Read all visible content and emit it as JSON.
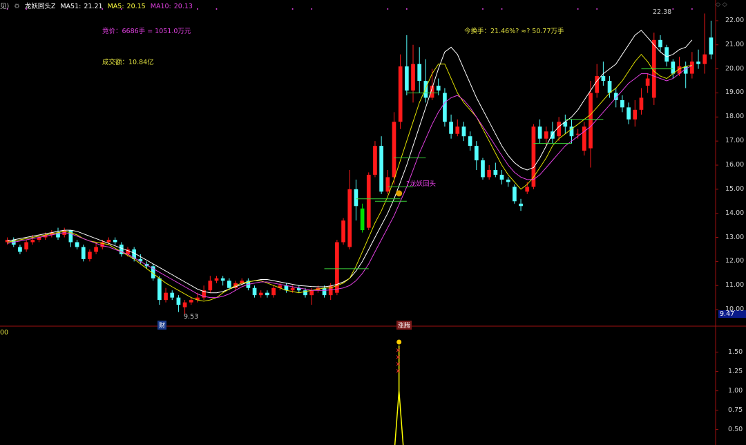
{
  "header": {
    "prefix": "见)",
    "indicator_name": "龙妖回头Z",
    "ma51_label": "MA51:",
    "ma51_value": "21.21",
    "ma5_label": "MA5:",
    "ma5_value": "20.15",
    "ma10_label": "MA10:",
    "ma10_value": "20.13"
  },
  "annotations": {
    "bid_text": "竞价：6686手 = 1051.0万元",
    "volume_text": "成交额：10.84亿",
    "turnover_text": "今换手：21.46%? ≈? 50.77万手",
    "pattern_label": "?龙妖回头",
    "high_label": "22.38",
    "low_label": "9.53",
    "current_price": "9.47",
    "lower_left": "00",
    "cai_marker": "财",
    "zhangting_marker": "涨腾"
  },
  "colors": {
    "up": "#ff1a1a",
    "down": "#54ffff",
    "green_bar": "#00e000",
    "ma5": "#ffffff",
    "ma10": "#e0e000",
    "ma20": "#e040e0",
    "signal": "#ffff00",
    "axis": "#a01010"
  },
  "chart_data": [
    {
      "type": "candlestick",
      "title": "",
      "y_ticks": [
        "22.00",
        "21.00",
        "20.00",
        "19.00",
        "18.00",
        "17.00",
        "16.00",
        "15.00",
        "14.00",
        "13.00",
        "12.00",
        "11.00",
        "10.00"
      ],
      "ylim": [
        9.6,
        22.4
      ],
      "series": [
        {
          "name": "MA51",
          "values": [
            12.85,
            12.9,
            12.95,
            13.0,
            13.05,
            13.1,
            13.15,
            13.2,
            13.25,
            13.3,
            13.3,
            13.25,
            13.15,
            13.05,
            12.95,
            12.85,
            12.75,
            12.65,
            12.55,
            12.45,
            12.35,
            12.2,
            12.05,
            11.9,
            11.75,
            11.6,
            11.45,
            11.3,
            11.15,
            11.0,
            10.85,
            10.75,
            10.7,
            10.7,
            10.75,
            10.85,
            10.95,
            11.05,
            11.15,
            11.2,
            11.25,
            11.25,
            11.2,
            11.15,
            11.1,
            11.05,
            11.0,
            10.98,
            10.96,
            10.95,
            10.95,
            10.98,
            11.05,
            11.15,
            11.3,
            11.6,
            12.0,
            12.5,
            13.0,
            13.5,
            14.0,
            14.6,
            15.3,
            16.0,
            16.8,
            17.6,
            18.4,
            19.2,
            20.0,
            20.7,
            20.9,
            20.6,
            20.0,
            19.4,
            18.8,
            18.3,
            17.8,
            17.3,
            16.8,
            16.4,
            16.1,
            15.9,
            15.8,
            15.9,
            16.3,
            16.8,
            17.3,
            17.6,
            17.8,
            18.0,
            18.3,
            18.7,
            19.1,
            19.5,
            19.8,
            20.0,
            20.2,
            20.6,
            21.0,
            21.4,
            21.6,
            21.3,
            21.0,
            20.7,
            20.5,
            20.6,
            20.8,
            20.9,
            21.2
          ]
        },
        {
          "name": "MA5",
          "values": [
            12.8,
            12.85,
            12.9,
            12.95,
            13.0,
            13.05,
            13.1,
            13.15,
            13.2,
            13.25,
            13.2,
            13.1,
            12.95,
            12.85,
            12.8,
            12.75,
            12.7,
            12.55,
            12.4,
            12.25,
            12.1,
            11.9,
            11.7,
            11.5,
            11.3,
            11.1,
            10.95,
            10.8,
            10.65,
            10.5,
            10.4,
            10.35,
            10.4,
            10.5,
            10.7,
            10.85,
            11.0,
            11.1,
            11.15,
            11.2,
            11.2,
            11.1,
            11.0,
            10.9,
            10.8,
            10.75,
            10.7,
            10.75,
            10.8,
            10.85,
            10.9,
            10.9,
            11.0,
            11.1,
            11.3,
            11.8,
            12.4,
            13.0,
            13.6,
            14.1,
            14.7,
            15.4,
            16.2,
            17.0,
            17.8,
            18.6,
            19.2,
            19.8,
            20.2,
            20.2,
            19.6,
            19.0,
            18.6,
            18.3,
            18.0,
            17.5,
            17.0,
            16.5,
            16.0,
            15.6,
            15.3,
            15.0,
            15.2,
            15.5,
            15.9,
            16.3,
            16.8,
            17.1,
            17.3,
            17.5,
            17.7,
            17.9,
            18.1,
            18.4,
            18.7,
            19.0,
            19.2,
            19.5,
            19.9,
            20.3,
            20.6,
            20.3,
            19.9,
            19.7,
            19.6,
            19.8,
            20.0,
            20.1,
            20.15
          ]
        },
        {
          "name": "MA10",
          "values": [
            12.75,
            12.8,
            12.85,
            12.9,
            12.95,
            13.0,
            13.05,
            13.1,
            13.15,
            13.2,
            13.15,
            13.05,
            12.95,
            12.85,
            12.75,
            12.65,
            12.6,
            12.5,
            12.4,
            12.3,
            12.15,
            12.0,
            11.85,
            11.7,
            11.55,
            11.4,
            11.25,
            11.1,
            10.95,
            10.8,
            10.65,
            10.55,
            10.5,
            10.5,
            10.55,
            10.65,
            10.8,
            10.95,
            11.05,
            11.1,
            11.15,
            11.15,
            11.1,
            11.05,
            11.0,
            10.95,
            10.9,
            10.85,
            10.8,
            10.8,
            10.8,
            10.82,
            10.85,
            10.9,
            11.0,
            11.2,
            11.5,
            11.9,
            12.4,
            12.9,
            13.4,
            13.9,
            14.5,
            15.1,
            15.8,
            16.5,
            17.1,
            17.7,
            18.2,
            18.6,
            18.8,
            18.9,
            18.7,
            18.4,
            18.0,
            17.6,
            17.2,
            16.8,
            16.4,
            16.0,
            15.7,
            15.5,
            15.4,
            15.4,
            15.6,
            15.9,
            16.2,
            16.5,
            16.8,
            17.0,
            17.2,
            17.4,
            17.6,
            17.9,
            18.2,
            18.5,
            18.8,
            19.1,
            19.4,
            19.6,
            19.8,
            19.8,
            19.7,
            19.6,
            19.5,
            19.6,
            19.8,
            20.0,
            20.13
          ]
        }
      ],
      "candles": [
        [
          12.8,
          12.9,
          12.7,
          13.0
        ],
        [
          12.9,
          12.7,
          12.6,
          13.0
        ],
        [
          12.6,
          12.4,
          12.3,
          12.7
        ],
        [
          12.5,
          12.8,
          12.4,
          12.9
        ],
        [
          12.8,
          12.9,
          12.7,
          13.1
        ],
        [
          12.9,
          13.0,
          12.8,
          13.1
        ],
        [
          13.0,
          13.1,
          12.9,
          13.2
        ],
        [
          13.1,
          13.2,
          13.0,
          13.3
        ],
        [
          13.2,
          13.0,
          12.9,
          13.4
        ],
        [
          13.1,
          13.3,
          13.0,
          13.4
        ],
        [
          13.3,
          12.8,
          12.6,
          13.3
        ],
        [
          12.8,
          12.6,
          12.5,
          12.9
        ],
        [
          12.6,
          12.1,
          12.0,
          12.7
        ],
        [
          12.1,
          12.4,
          12.0,
          12.5
        ],
        [
          12.4,
          12.6,
          12.3,
          12.8
        ],
        [
          12.6,
          12.8,
          12.5,
          12.9
        ],
        [
          12.8,
          12.9,
          12.7,
          13.0
        ],
        [
          12.9,
          12.8,
          12.7,
          13.0
        ],
        [
          12.7,
          12.3,
          12.2,
          12.8
        ],
        [
          12.3,
          12.5,
          12.2,
          12.6
        ],
        [
          12.5,
          12.1,
          12.0,
          12.6
        ],
        [
          12.1,
          12.0,
          11.9,
          12.3
        ],
        [
          11.9,
          11.8,
          11.7,
          12.0
        ],
        [
          11.8,
          11.3,
          11.2,
          11.9
        ],
        [
          11.3,
          10.4,
          10.2,
          11.4
        ],
        [
          10.4,
          10.7,
          10.3,
          10.9
        ],
        [
          10.7,
          10.5,
          10.4,
          10.8
        ],
        [
          10.5,
          10.2,
          9.9,
          10.6
        ],
        [
          10.1,
          10.3,
          9.8,
          10.4
        ],
        [
          10.3,
          10.4,
          10.2,
          10.5
        ],
        [
          10.4,
          10.5,
          10.3,
          10.7
        ],
        [
          10.5,
          10.8,
          10.4,
          11.0
        ],
        [
          10.8,
          11.2,
          10.7,
          11.4
        ],
        [
          11.2,
          11.3,
          11.1,
          11.4
        ],
        [
          11.3,
          11.2,
          11.0,
          11.4
        ],
        [
          11.2,
          10.9,
          10.8,
          11.3
        ],
        [
          10.9,
          11.1,
          10.8,
          11.2
        ],
        [
          11.1,
          11.2,
          11.0,
          11.3
        ],
        [
          11.2,
          10.9,
          10.8,
          11.3
        ],
        [
          10.9,
          10.6,
          10.5,
          11.0
        ],
        [
          10.6,
          10.7,
          10.5,
          10.8
        ],
        [
          10.7,
          10.6,
          10.5,
          10.8
        ],
        [
          10.6,
          10.9,
          10.5,
          11.0
        ],
        [
          10.9,
          11.0,
          10.8,
          11.1
        ],
        [
          11.0,
          10.8,
          10.7,
          11.1
        ],
        [
          10.8,
          10.9,
          10.7,
          11.0
        ],
        [
          10.9,
          10.8,
          10.7,
          11.0
        ],
        [
          10.8,
          10.6,
          10.5,
          10.9
        ],
        [
          10.6,
          10.8,
          10.2,
          10.9
        ],
        [
          10.8,
          10.9,
          10.7,
          11.0
        ],
        [
          10.9,
          10.6,
          10.5,
          11.0
        ],
        [
          10.6,
          11.0,
          10.4,
          11.1
        ],
        [
          10.7,
          12.8,
          10.6,
          12.9
        ],
        [
          12.8,
          13.7,
          12.7,
          13.8
        ],
        [
          12.6,
          15.0,
          12.5,
          15.8
        ],
        [
          15.0,
          14.3,
          13.7,
          15.4
        ],
        [
          14.2,
          13.3,
          13.2,
          14.4
        ],
        [
          13.4,
          15.6,
          13.3,
          15.7
        ],
        [
          15.6,
          16.8,
          15.5,
          17.0
        ],
        [
          16.8,
          14.9,
          14.8,
          17.2
        ],
        [
          14.9,
          15.5,
          14.8,
          15.8
        ],
        [
          15.5,
          17.8,
          15.2,
          18.2
        ],
        [
          17.8,
          20.1,
          17.5,
          20.6
        ],
        [
          20.1,
          19.1,
          18.9,
          21.4
        ],
        [
          19.1,
          20.2,
          18.6,
          21.0
        ],
        [
          20.2,
          19.5,
          19.0,
          20.9
        ],
        [
          19.5,
          18.8,
          18.6,
          20.4
        ],
        [
          18.8,
          19.3,
          18.7,
          20.0
        ],
        [
          19.3,
          19.1,
          18.9,
          19.6
        ],
        [
          19.0,
          17.8,
          17.6,
          19.2
        ],
        [
          17.8,
          17.3,
          17.1,
          18.1
        ],
        [
          17.3,
          17.6,
          17.2,
          17.9
        ],
        [
          17.6,
          17.2,
          17.0,
          17.8
        ],
        [
          17.2,
          16.8,
          16.6,
          17.4
        ],
        [
          16.8,
          16.2,
          15.8,
          17.0
        ],
        [
          16.2,
          15.5,
          15.4,
          16.3
        ],
        [
          15.5,
          15.8,
          15.4,
          16.0
        ],
        [
          15.8,
          15.6,
          15.5,
          16.1
        ],
        [
          15.6,
          15.4,
          15.2,
          15.8
        ],
        [
          15.4,
          15.3,
          15.1,
          15.5
        ],
        [
          15.1,
          14.5,
          14.4,
          15.2
        ],
        [
          14.4,
          14.3,
          14.1,
          14.6
        ],
        [
          14.9,
          15.1,
          14.8,
          15.3
        ],
        [
          15.1,
          17.6,
          15.0,
          17.7
        ],
        [
          17.6,
          17.1,
          16.9,
          17.9
        ],
        [
          17.1,
          17.4,
          16.8,
          17.6
        ],
        [
          17.4,
          17.1,
          16.9,
          17.8
        ],
        [
          17.2,
          17.8,
          17.0,
          18.0
        ],
        [
          17.8,
          17.6,
          17.3,
          18.1
        ],
        [
          17.6,
          17.2,
          16.9,
          17.9
        ],
        [
          17.3,
          17.3,
          17.1,
          17.5
        ],
        [
          16.6,
          17.6,
          16.4,
          17.8
        ],
        [
          16.7,
          19.0,
          15.9,
          19.5
        ],
        [
          19.0,
          19.7,
          18.8,
          20.2
        ],
        [
          19.7,
          19.5,
          19.3,
          20.3
        ],
        [
          19.5,
          19.0,
          18.8,
          19.7
        ],
        [
          19.0,
          18.7,
          18.4,
          19.2
        ],
        [
          18.7,
          18.4,
          18.2,
          18.9
        ],
        [
          18.4,
          17.9,
          17.7,
          18.6
        ],
        [
          17.9,
          18.3,
          17.6,
          18.7
        ],
        [
          18.3,
          18.8,
          18.1,
          19.2
        ],
        [
          19.3,
          19.6,
          19.0,
          19.8
        ],
        [
          18.8,
          21.2,
          18.5,
          21.5
        ],
        [
          21.2,
          20.9,
          20.7,
          21.4
        ],
        [
          20.9,
          20.3,
          20.1,
          21.0
        ],
        [
          20.3,
          19.8,
          19.6,
          20.4
        ],
        [
          19.8,
          20.1,
          19.7,
          20.5
        ],
        [
          20.1,
          19.8,
          19.2,
          20.3
        ],
        [
          19.8,
          20.3,
          19.6,
          20.7
        ],
        [
          20.3,
          20.2,
          20.0,
          20.8
        ],
        [
          20.2,
          20.6,
          19.8,
          22.3
        ],
        [
          21.3,
          20.6,
          20.4,
          22.0
        ]
      ]
    },
    {
      "type": "line",
      "title": "",
      "y_ticks": [
        "1.50",
        "1.25",
        "1.00",
        "0.75",
        "0.50"
      ],
      "ylim": [
        0.3,
        1.8
      ],
      "signal_index": 62
    }
  ]
}
